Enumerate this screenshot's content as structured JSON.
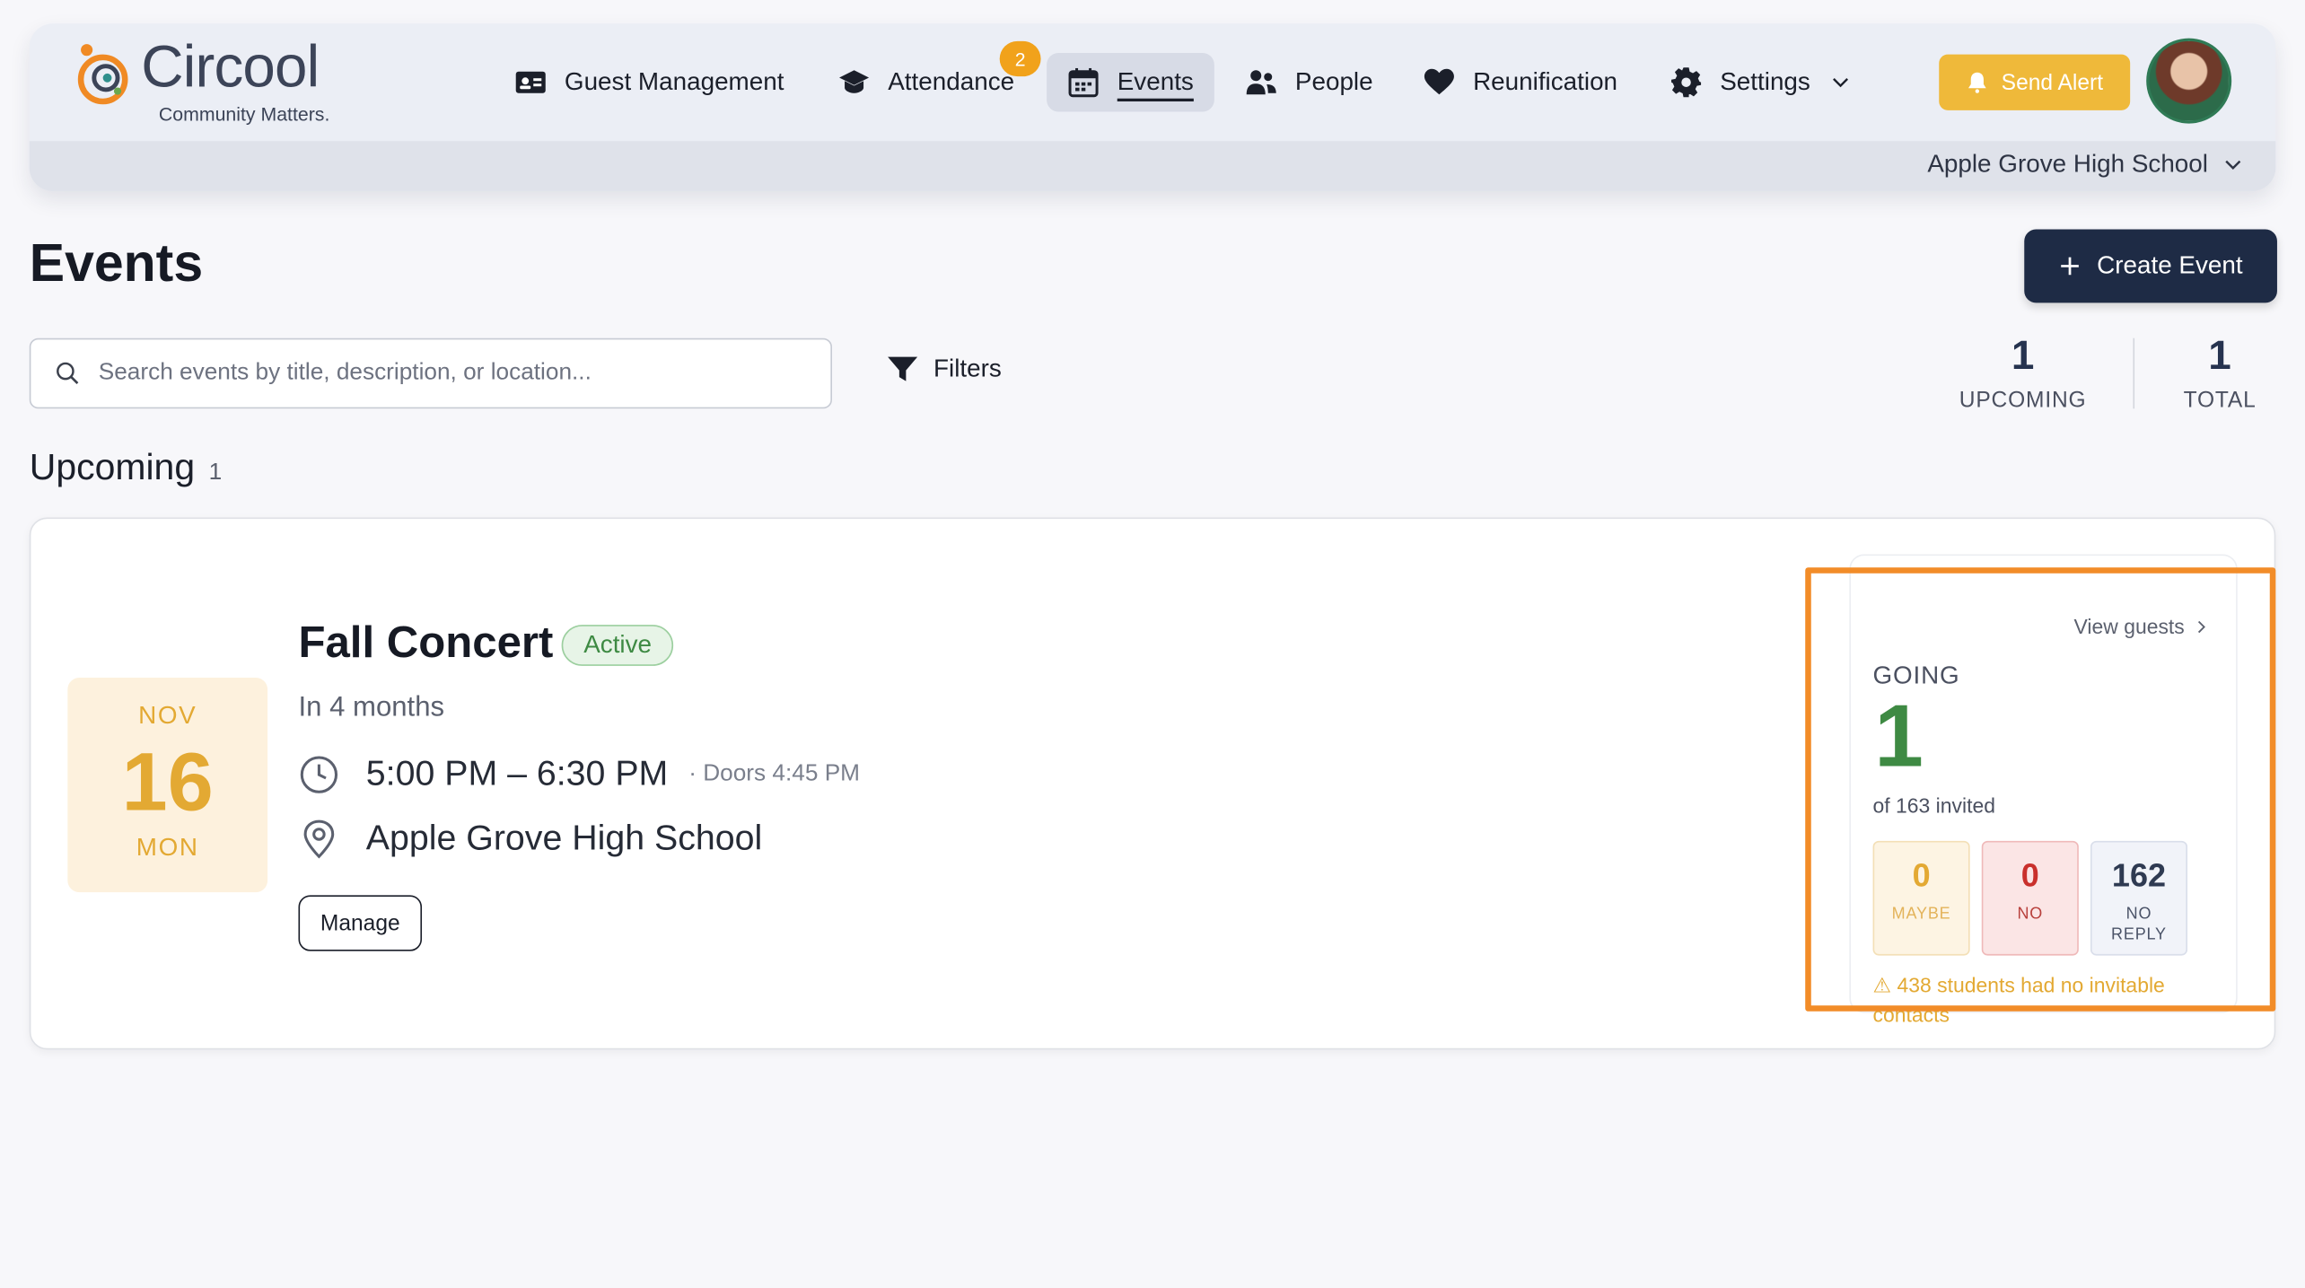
{
  "brand": {
    "name": "Circool",
    "tagline": "Community Matters."
  },
  "nav": {
    "items": [
      {
        "label": "Guest Management",
        "icon": "id-card-icon"
      },
      {
        "label": "Attendance",
        "icon": "graduation-cap-icon",
        "badge": "2"
      },
      {
        "label": "Events",
        "icon": "calendar-icon",
        "active": true
      },
      {
        "label": "People",
        "icon": "people-icon"
      },
      {
        "label": "Reunification",
        "icon": "heart-icon"
      },
      {
        "label": "Settings",
        "icon": "gear-icon"
      }
    ]
  },
  "header": {
    "send_alert": "Send Alert",
    "school": "Apple Grove High School"
  },
  "page": {
    "title": "Events",
    "create_button": "Create Event",
    "search_placeholder": "Search events by title, description, or location...",
    "filters": "Filters",
    "stats": [
      {
        "value": "1",
        "label": "UPCOMING"
      },
      {
        "value": "1",
        "label": "TOTAL"
      }
    ],
    "section_title": "Upcoming",
    "section_count": "1"
  },
  "event": {
    "month": "NOV",
    "day": "16",
    "weekday": "MON",
    "title": "Fall Concert",
    "status": "Active",
    "relative": "In 4 months",
    "time": "5:00 PM – 6:30 PM",
    "doors": "· Doors 4:45 PM",
    "location": "Apple Grove High School",
    "manage_button": "Manage",
    "rsvp": {
      "view_guests": "View guests",
      "going_label": "GOING",
      "going": "1",
      "of_invited": "of 163 invited",
      "maybe": {
        "value": "0",
        "label": "MAYBE"
      },
      "no": {
        "value": "0",
        "label": "NO"
      },
      "no_reply": {
        "value": "162",
        "label": "NO REPLY"
      },
      "warning": "⚠ 438 students had no invitable contacts"
    }
  },
  "colors": {
    "accent": "#1e2b45",
    "alert": "#efb93a",
    "going": "#3e8a43",
    "highlight": "#f28c28"
  }
}
